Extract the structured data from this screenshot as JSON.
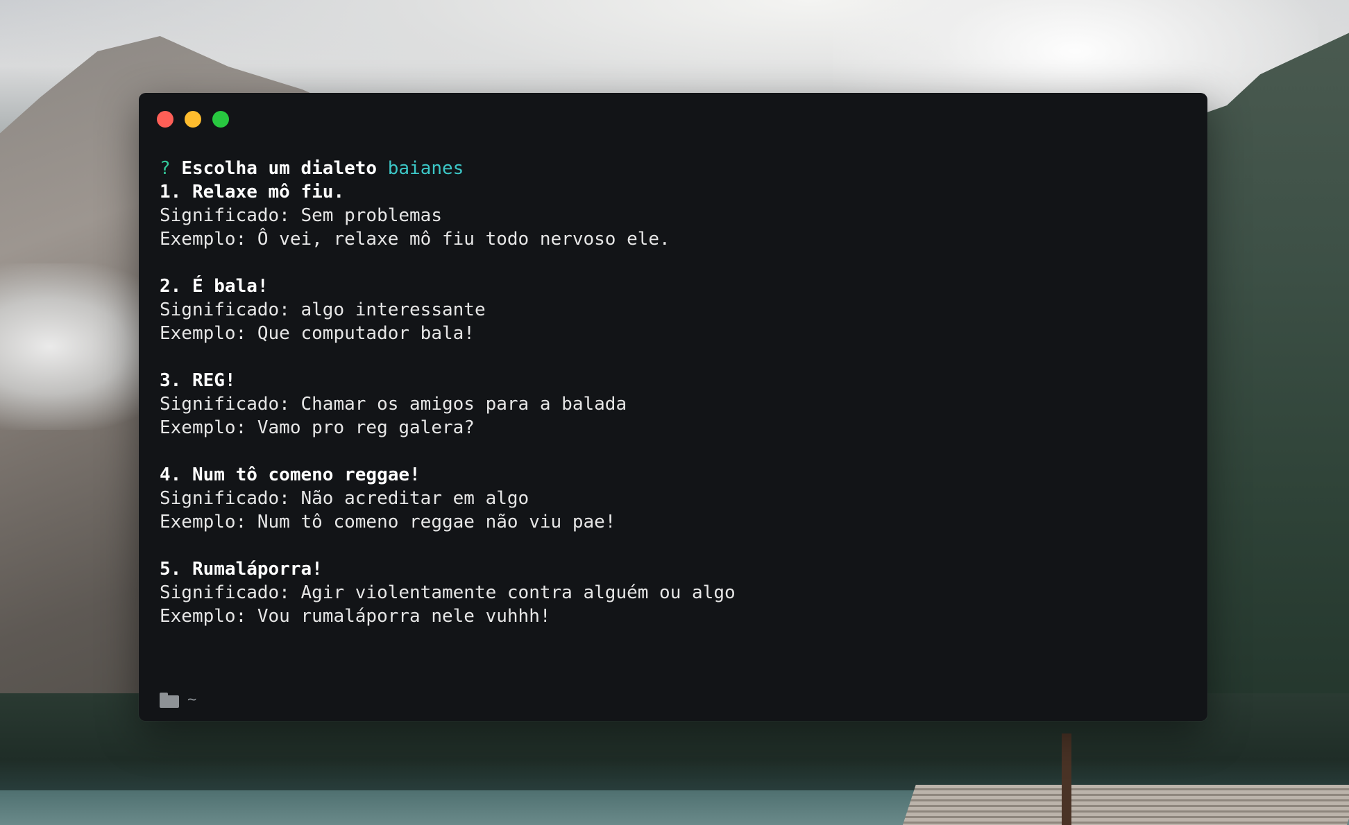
{
  "terminal": {
    "prompt_mark": "?",
    "prompt_text": "Escolha um dialeto",
    "prompt_answer": "baianes",
    "entries": [
      {
        "title": "1. Relaxe mô fiu.",
        "meaning": "Significado: Sem problemas",
        "example": "Exemplo: Ô vei, relaxe mô fiu todo nervoso ele."
      },
      {
        "title": "2. É bala!",
        "meaning": "Significado: algo interessante",
        "example": "Exemplo: Que computador bala!"
      },
      {
        "title": "3. REG!",
        "meaning": "Significado: Chamar os amigos para a balada",
        "example": "Exemplo: Vamo pro reg galera?"
      },
      {
        "title": "4. Num tô comeno reggae!",
        "meaning": "Significado: Não acreditar em algo",
        "example": "Exemplo: Num tô comeno reggae não viu pae!"
      },
      {
        "title": "5. Rumaláporra!",
        "meaning": "Significado: Agir violentamente contra alguém ou algo",
        "example": "Exemplo: Vou rumaláporra nele vuhhh!"
      }
    ],
    "status": {
      "icon": "folder-icon",
      "path": "~"
    }
  },
  "colors": {
    "prompt_mark": "#33c99a",
    "prompt_answer": "#3cc7c7",
    "window_bg": "#121417",
    "close": "#fe5f57",
    "minimize": "#febc2e",
    "maximize": "#28c840"
  }
}
